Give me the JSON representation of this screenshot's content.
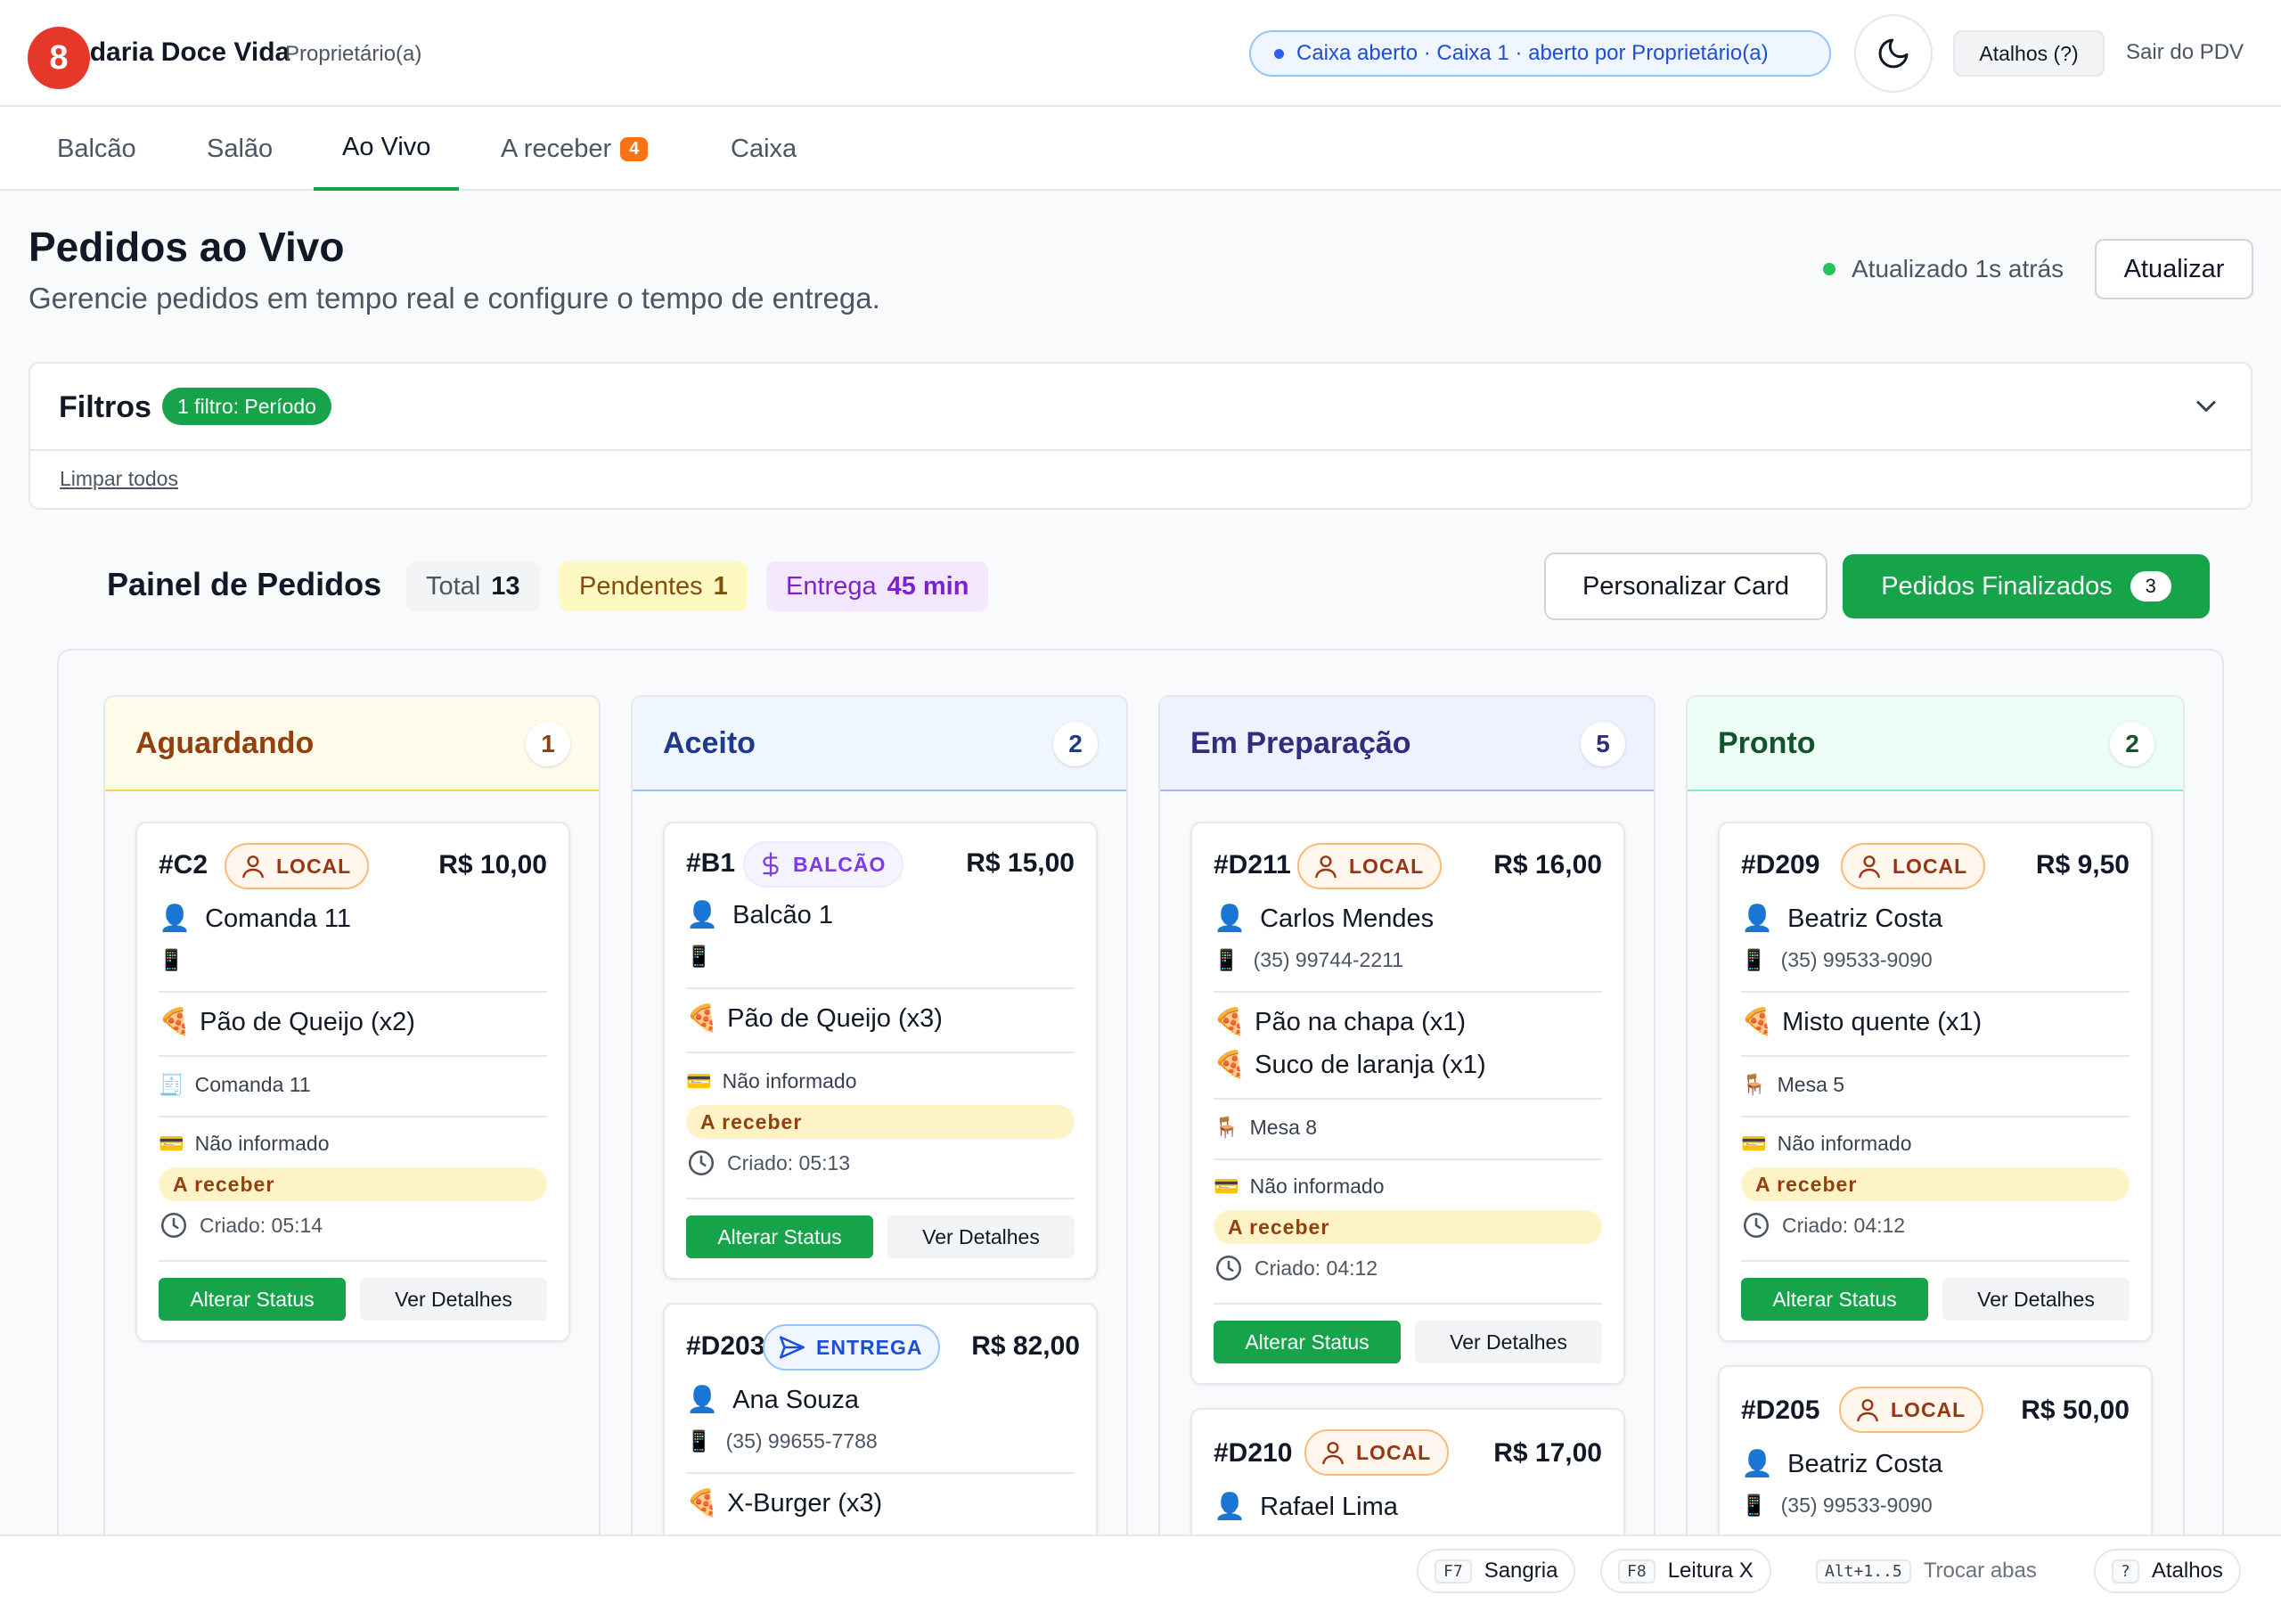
{
  "header": {
    "store_name": "Padaria Doce Vida",
    "notification_count": "8",
    "role": "Proprietário(a)",
    "caixa_status": "Caixa aberto · Caixa 1 · aberto por Proprietário(a)",
    "theme_icon": "moon-icon",
    "shortcuts_label": "Atalhos (?)",
    "logout_label": "Sair do PDV"
  },
  "tabs": [
    {
      "label": "Balcão"
    },
    {
      "label": "Salão"
    },
    {
      "label": "Ao Vivo",
      "active": true
    },
    {
      "label": "A receber",
      "count": "4"
    },
    {
      "label": "Caixa"
    }
  ],
  "page": {
    "title": "Pedidos ao Vivo",
    "subtitle": "Gerencie pedidos em tempo real e configure o tempo de entrega.",
    "updated": "Atualizado 1s atrás",
    "refresh_label": "Atualizar"
  },
  "filters": {
    "title": "Filtros",
    "badge": "1 filtro: Período",
    "clear_label": "Limpar todos"
  },
  "panel": {
    "title": "Painel de Pedidos",
    "total_label": "Total",
    "total_value": "13",
    "pending_label": "Pendentes",
    "pending_value": "1",
    "delivery_label": "Entrega",
    "delivery_value": "45 min",
    "customize_label": "Personalizar Card",
    "finished_label": "Pedidos Finalizados",
    "finished_count": "3"
  },
  "colors": {
    "accent": "#16a34a",
    "pending_bg": "#fef9c3",
    "delivery_bg": "#f3e8ff",
    "badge_orange": "#f97316",
    "notification_red": "#e5372a"
  },
  "columns": [
    {
      "title": "Aguardando",
      "count": "1"
    },
    {
      "title": "Aceito",
      "count": "2"
    },
    {
      "title": "Em Preparação",
      "count": "5"
    },
    {
      "title": "Pronto",
      "count": "2"
    }
  ],
  "cards": [
    {
      "id": "#C2",
      "type": "LOCAL",
      "price": "R$ 10,00",
      "customer": "Comanda 11",
      "phone": "",
      "items": [
        "Pão de Queijo (x2)"
      ],
      "location": "Comanda 11",
      "payment": "Não informado",
      "receivable": "A receber",
      "created": "Criado: 05:14",
      "status_btn": "Alterar Status",
      "details_btn": "Ver Detalhes"
    },
    {
      "id": "#B1",
      "type": "BALCÃO",
      "price": "R$ 15,00",
      "customer": "Balcão 1",
      "phone": "",
      "items": [
        "Pão de Queijo (x3)"
      ],
      "payment": "Não informado",
      "receivable": "A receber",
      "created": "Criado: 05:13",
      "status_btn": "Alterar Status",
      "details_btn": "Ver Detalhes"
    },
    {
      "id": "#D203",
      "type": "ENTREGA",
      "price": "R$ 82,00",
      "customer": "Ana Souza",
      "phone": "(35) 99655-7788",
      "items": [
        "X-Burger (x3)"
      ]
    },
    {
      "id": "#D211",
      "type": "LOCAL",
      "price": "R$ 16,00",
      "customer": "Carlos Mendes",
      "phone": "(35) 99744-2211",
      "items": [
        "Pão na chapa (x1)",
        "Suco de laranja (x1)"
      ],
      "location": "Mesa 8",
      "payment": "Não informado",
      "receivable": "A receber",
      "created": "Criado: 04:12",
      "status_btn": "Alterar Status",
      "details_btn": "Ver Detalhes"
    },
    {
      "id": "#D210",
      "type": "LOCAL",
      "price": "R$ 17,00",
      "customer": "Rafael Lima"
    },
    {
      "id": "#D209",
      "type": "LOCAL",
      "price": "R$ 9,50",
      "customer": "Beatriz Costa",
      "phone": "(35) 99533-9090",
      "items": [
        "Misto quente (x1)"
      ],
      "location": "Mesa 5",
      "payment": "Não informado",
      "receivable": "A receber",
      "created": "Criado: 04:12",
      "status_btn": "Alterar Status",
      "details_btn": "Ver Detalhes"
    },
    {
      "id": "#D205",
      "type": "LOCAL",
      "price": "R$ 50,00",
      "customer": "Beatriz Costa",
      "phone": "(35) 99533-9090"
    }
  ],
  "footer": [
    {
      "key": "F7",
      "label": "Sangria"
    },
    {
      "key": "F8",
      "label": "Leitura X"
    },
    {
      "key": "Alt+1..5",
      "label": "Trocar abas"
    },
    {
      "key": "?",
      "label": "Atalhos"
    }
  ]
}
